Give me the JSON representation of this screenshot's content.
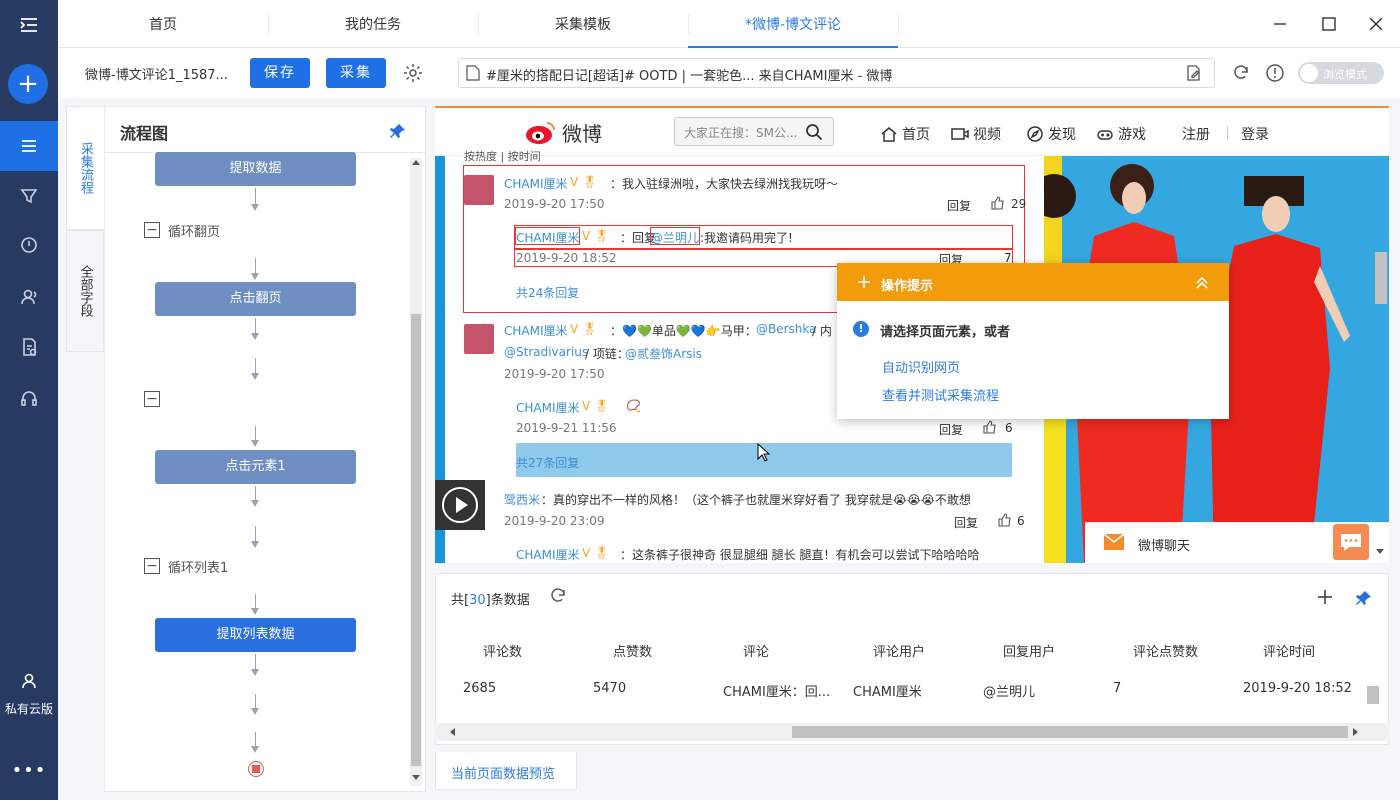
{
  "sidebar": {
    "cloud_label": "私有云版",
    "more": "•••"
  },
  "tabs": [
    {
      "label": "首页"
    },
    {
      "label": "我的任务"
    },
    {
      "label": "采集模板"
    },
    {
      "label": "*微博-博文评论"
    }
  ],
  "toolbar": {
    "project_name": "微博-博文评论1_1587...",
    "save_label": "保存",
    "collect_label": "采集"
  },
  "url": "#厘米的搭配日记[超话]# OOTD | 一套驼色... 来自CHAMI厘米 - 微博",
  "browse_mode_label": "浏览模式",
  "side_tabs": [
    "采集流程",
    "全部字段"
  ],
  "flow": {
    "title": "流程图",
    "nodes": [
      "提取数据",
      "点击翻页",
      "点击元素1",
      "提取列表数据"
    ],
    "loops": [
      "循环翻页",
      "",
      "循环列表1"
    ]
  },
  "weibo": {
    "logo": "微博",
    "search_placeholder": "大家正在搜：SM公...",
    "nav": [
      "首页",
      "视频",
      "发现",
      "游戏",
      "注册",
      "登录"
    ],
    "sort_text": "按热度  |  按时间",
    "comments": [
      {
        "user": "CHAMI厘米",
        "text": "：我入驻绿洲啦，大家快去绿洲找我玩呀～",
        "date": "2019-9-20 17:50",
        "reply": "回复",
        "likes": "29"
      },
      {
        "user": "CHAMI厘米",
        "text": "：回复",
        "mention": "@兰明儿",
        "text2": ":我邀请码用完了!",
        "date": "2019-9-20 18:52",
        "reply": "回复",
        "likes": "7"
      },
      {
        "more": "共24条回复"
      },
      {
        "user": "CHAMI厘米",
        "text": "：💙💚单品💚💙👉马甲：",
        "mention": "@Bershka",
        "text2": " / 内",
        "line2_mention": "@Stradivarius",
        "line2_text": " / 项链：",
        "line2_mention2": "@贰叁饰Arsis",
        "date": "2019-9-20 17:50"
      },
      {
        "user": "CHAMI厘米",
        "text": "📿",
        "date": "2019-9-21 11:56",
        "reply": "回复",
        "likes": "6"
      },
      {
        "more": "共27条回复"
      },
      {
        "user": "鹭西米",
        "text": "：真的穿出不一样的风格！（这个裤子也就厘米穿好看了 我穿就是😭😭😭不敢想",
        "date": "2019-9-20 23:09",
        "reply": "回复",
        "likes": "6"
      },
      {
        "user": "CHAMI厘米",
        "text": "：这条裤子很神奇 很显腿细 腿长 腿直！有机会可以尝试下哈哈哈哈"
      }
    ],
    "chat_label": "微博聊天"
  },
  "tip": {
    "title": "操作提示",
    "message": "请选择页面元素，或者",
    "links": [
      "自动识别网页",
      "查看并测试采集流程"
    ]
  },
  "data": {
    "count_prefix": "共[",
    "count": "30",
    "count_suffix": "]条数据",
    "columns": [
      "评论数",
      "点赞数",
      "评论",
      "评论用户",
      "回复用户",
      "评论点赞数",
      "评论时间"
    ],
    "rows": [
      [
        "2685",
        "5470",
        "CHAMI厘米：回...",
        "CHAMI厘米",
        "@兰明儿",
        "7",
        "2019-9-20 18:52"
      ]
    ],
    "preview_label": "当前页面数据预览"
  },
  "colors": {
    "primary": "#1f6fe5",
    "sidebar": "#273a62",
    "tip": "#f29b0b",
    "weibo_orange": "#f58b2c"
  }
}
